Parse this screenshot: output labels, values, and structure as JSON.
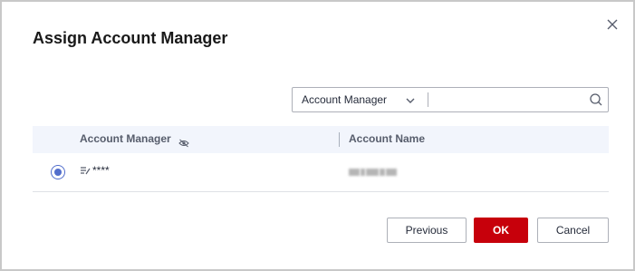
{
  "dialog": {
    "title": "Assign Account Manager",
    "close_icon": "close-icon"
  },
  "search": {
    "filter_selected": "Account Manager",
    "value": "",
    "placeholder": "",
    "dropdown_icon": "chevron-down-icon",
    "search_icon": "search-icon"
  },
  "table": {
    "columns": [
      {
        "label": "Account Manager",
        "icon": "eye-off-icon"
      },
      {
        "label": "Account Name"
      }
    ],
    "rows": [
      {
        "selected": true,
        "account_manager": "****",
        "manager_icon": "edit-user-icon",
        "account_name": ""
      }
    ]
  },
  "footer": {
    "previous_label": "Previous",
    "ok_label": "OK",
    "cancel_label": "Cancel"
  },
  "colors": {
    "primary": "#c7000b",
    "radio": "#526ecc",
    "header_bg": "#f2f5fc"
  }
}
